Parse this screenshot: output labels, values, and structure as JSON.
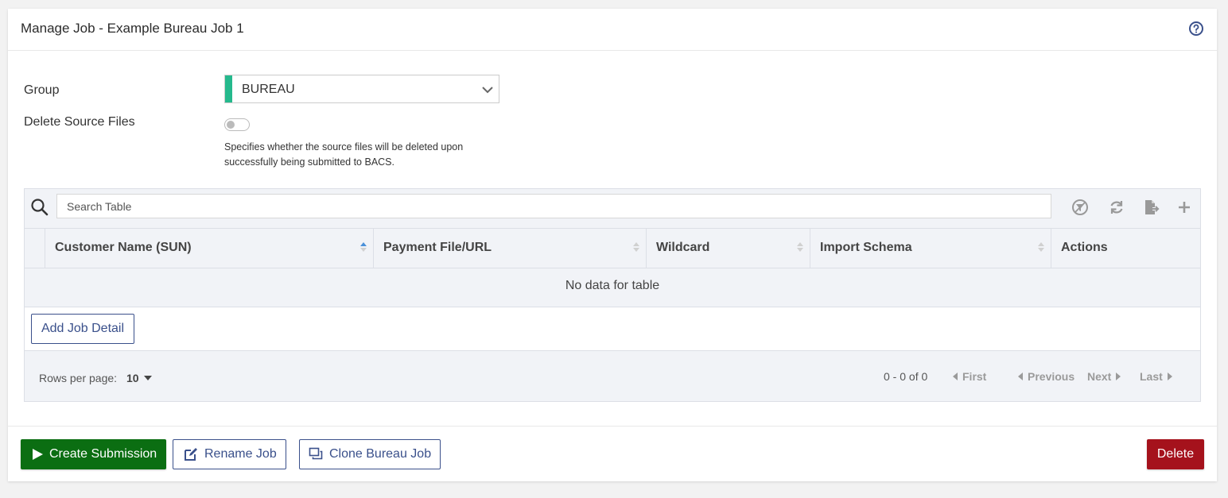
{
  "header": {
    "title": "Manage Job - Example Bureau Job 1",
    "help_icon": "question-circle-icon"
  },
  "form": {
    "group_label": "Group",
    "group_value": "BUREAU",
    "delete_source_label": "Delete Source Files",
    "delete_source_enabled": false,
    "delete_source_help": "Specifies whether the source files will be deleted upon successfully being submitted to BACS."
  },
  "table": {
    "search_placeholder": "Search Table",
    "toolbar_icons": [
      "clear-filter-icon",
      "refresh-icon",
      "export-icon",
      "add-icon"
    ],
    "columns": [
      {
        "label": "Customer Name (SUN)",
        "sort": "asc"
      },
      {
        "label": "Payment File/URL",
        "sort": "none"
      },
      {
        "label": "Wildcard",
        "sort": "none"
      },
      {
        "label": "Import Schema",
        "sort": "none"
      },
      {
        "label": "Actions",
        "sort": "none"
      }
    ],
    "empty_text": "No data for table",
    "add_button": "Add Job Detail",
    "rows_per_page_label": "Rows per page:",
    "rows_per_page_value": "10",
    "page_info": "0 - 0 of 0",
    "pager": {
      "first": "First",
      "previous": "Previous",
      "next": "Next",
      "last": "Last"
    }
  },
  "actions": {
    "create_submission": "Create Submission",
    "rename_job": "Rename Job",
    "clone_job": "Clone Bureau Job",
    "delete": "Delete"
  },
  "colors": {
    "primary_outline": "#3a508b",
    "success": "#0b6e12",
    "danger": "#a5121c",
    "group_accent": "#25b98d"
  }
}
